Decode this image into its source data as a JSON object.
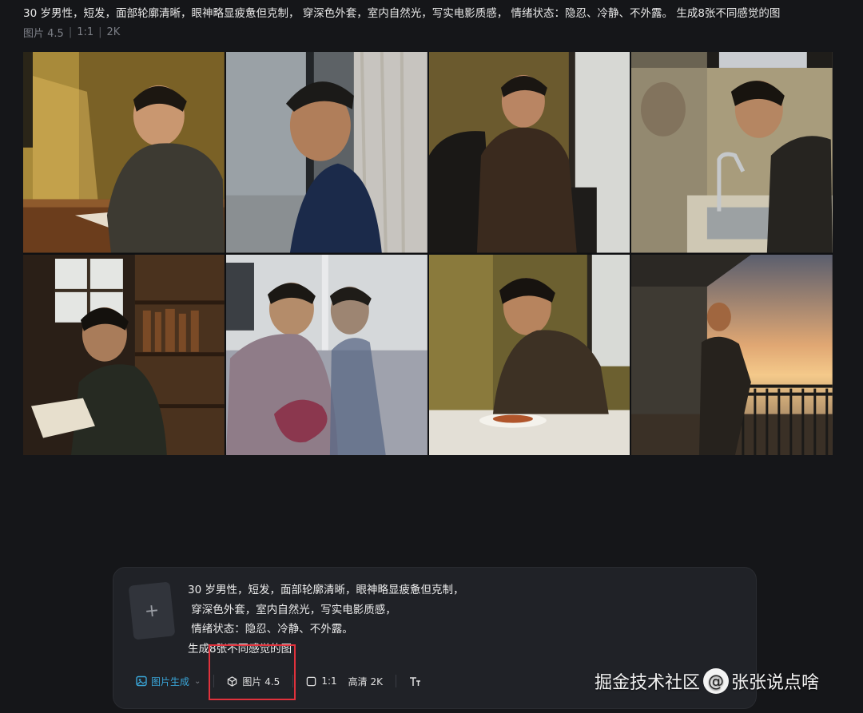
{
  "header": {
    "prompt_text": "30 岁男性，短发，面部轮廓清晰，眼神略显疲惫但克制， 穿深色外套，室内自然光，写实电影质感， 情绪状态：隐忍、冷静、不外露。 生成8张不同感觉的图",
    "meta": [
      "图片 4.5",
      "1:1",
      "2K"
    ]
  },
  "gallery": {
    "count": 8
  },
  "composer": {
    "upload_glyph": "+",
    "lines": [
      "30 岁男性，短发，面部轮廓清晰，眼神略显疲惫但克制，",
      " 穿深色外套，室内自然光，写实电影质感，",
      " 情绪状态：隐忍、冷静、不外露。",
      "生成8张不同感觉的图"
    ],
    "toolbar": {
      "mode_label": "图片生成",
      "model_label": "图片 4.5",
      "ratio_label": "1:1",
      "quality_label": "高清 2K"
    }
  },
  "watermark": {
    "left": "掘金技术社区",
    "at": "@",
    "right": "张张说点啥"
  },
  "colors": {
    "background": "#151619",
    "panel": "#202227",
    "accent": "#3aa6d8",
    "highlight": "#e0323c"
  }
}
